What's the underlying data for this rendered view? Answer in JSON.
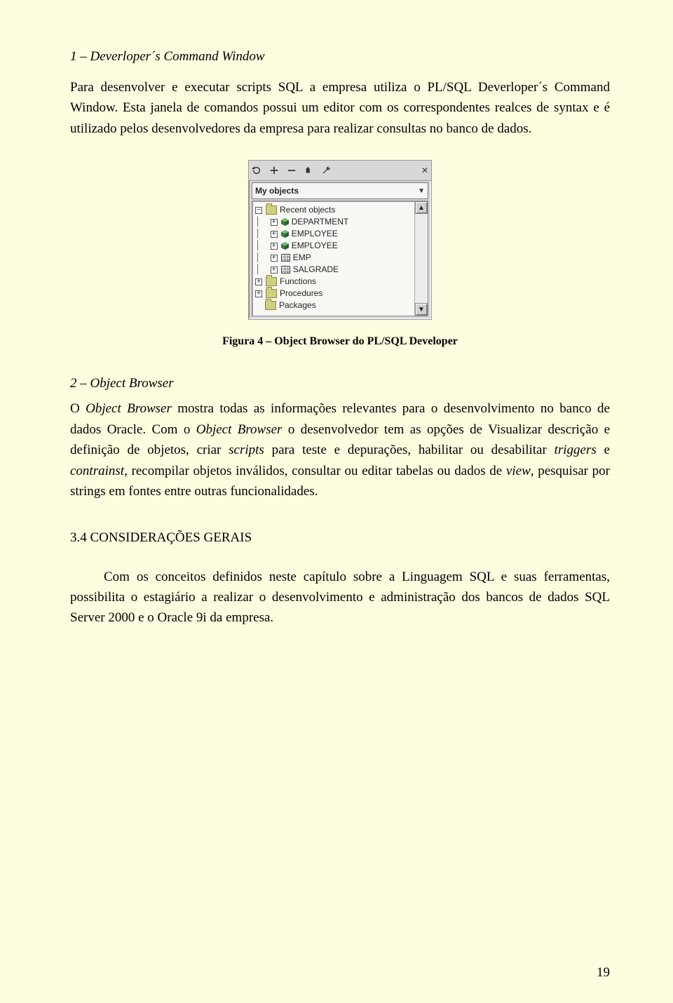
{
  "section1": {
    "heading": "1 – Deverloper´s Command Window",
    "para": "Para desenvolver e executar scripts SQL a empresa utiliza o PL/SQL Deverloper´s Command Window. Esta janela de comandos possui um editor com os correspondentes realces de syntax e é utilizado pelos desenvolvedores da empresa para realizar consultas no banco de dados."
  },
  "figure": {
    "combo_label": "My objects",
    "toolbar_icons": [
      "refresh-icon",
      "plus-icon",
      "minus-icon",
      "search-icon",
      "wrench-icon"
    ],
    "tree": [
      {
        "toggle": "-",
        "indent": 0,
        "icon": "folder",
        "label": "Recent objects"
      },
      {
        "toggle": "+",
        "indent": 1,
        "icon": "cube",
        "label": "DEPARTMENT"
      },
      {
        "toggle": "+",
        "indent": 1,
        "icon": "cube",
        "label": "EMPLOYEE"
      },
      {
        "toggle": "+",
        "indent": 1,
        "icon": "cube",
        "label": "EMPLOYEE"
      },
      {
        "toggle": "+",
        "indent": 1,
        "icon": "table",
        "label": "EMP"
      },
      {
        "toggle": "+",
        "indent": 1,
        "icon": "table",
        "label": "SALGRADE"
      },
      {
        "toggle": "+",
        "indent": 0,
        "icon": "folder",
        "label": "Functions"
      },
      {
        "toggle": "+",
        "indent": 0,
        "icon": "folder",
        "label": "Procedures"
      },
      {
        "toggle": "",
        "indent": 0,
        "icon": "folder",
        "label": "Packages"
      }
    ],
    "caption": "Figura 4 – Object Browser do PL/SQL Developer"
  },
  "section2": {
    "heading": "2 – Object Browser",
    "para_parts": [
      {
        "t": "O ",
        "i": false
      },
      {
        "t": "Object Browser",
        "i": true
      },
      {
        "t": " mostra todas as informações relevantes para o desenvolvimento no banco de dados Oracle. Com o ",
        "i": false
      },
      {
        "t": "Object Browser",
        "i": true
      },
      {
        "t": " o desenvolvedor tem as opções de Visualizar descrição e definição de objetos, criar ",
        "i": false
      },
      {
        "t": "scripts",
        "i": true
      },
      {
        "t": " para teste e depurações, habilitar ou desabilitar ",
        "i": false
      },
      {
        "t": "triggers",
        "i": true
      },
      {
        "t": " e ",
        "i": false
      },
      {
        "t": "contrainst",
        "i": true
      },
      {
        "t": ", recompilar objetos inválidos, consultar ou editar tabelas ou dados de ",
        "i": false
      },
      {
        "t": "view",
        "i": true
      },
      {
        "t": ", pesquisar por strings em fontes entre outras funcionalidades.",
        "i": false
      }
    ]
  },
  "section3": {
    "heading": "3.4 CONSIDERAÇÕES GERAIS",
    "para": "Com os conceitos definidos neste capítulo sobre a Linguagem SQL e suas ferramentas, possibilita o estagiário a realizar o desenvolvimento e administração dos bancos de dados SQL Server 2000 e o Oracle 9i da empresa."
  },
  "page_number": "19",
  "glyphs": {
    "close": "✕",
    "tri_up": "▲",
    "tri_down": "▼",
    "chev_down": "▼"
  }
}
